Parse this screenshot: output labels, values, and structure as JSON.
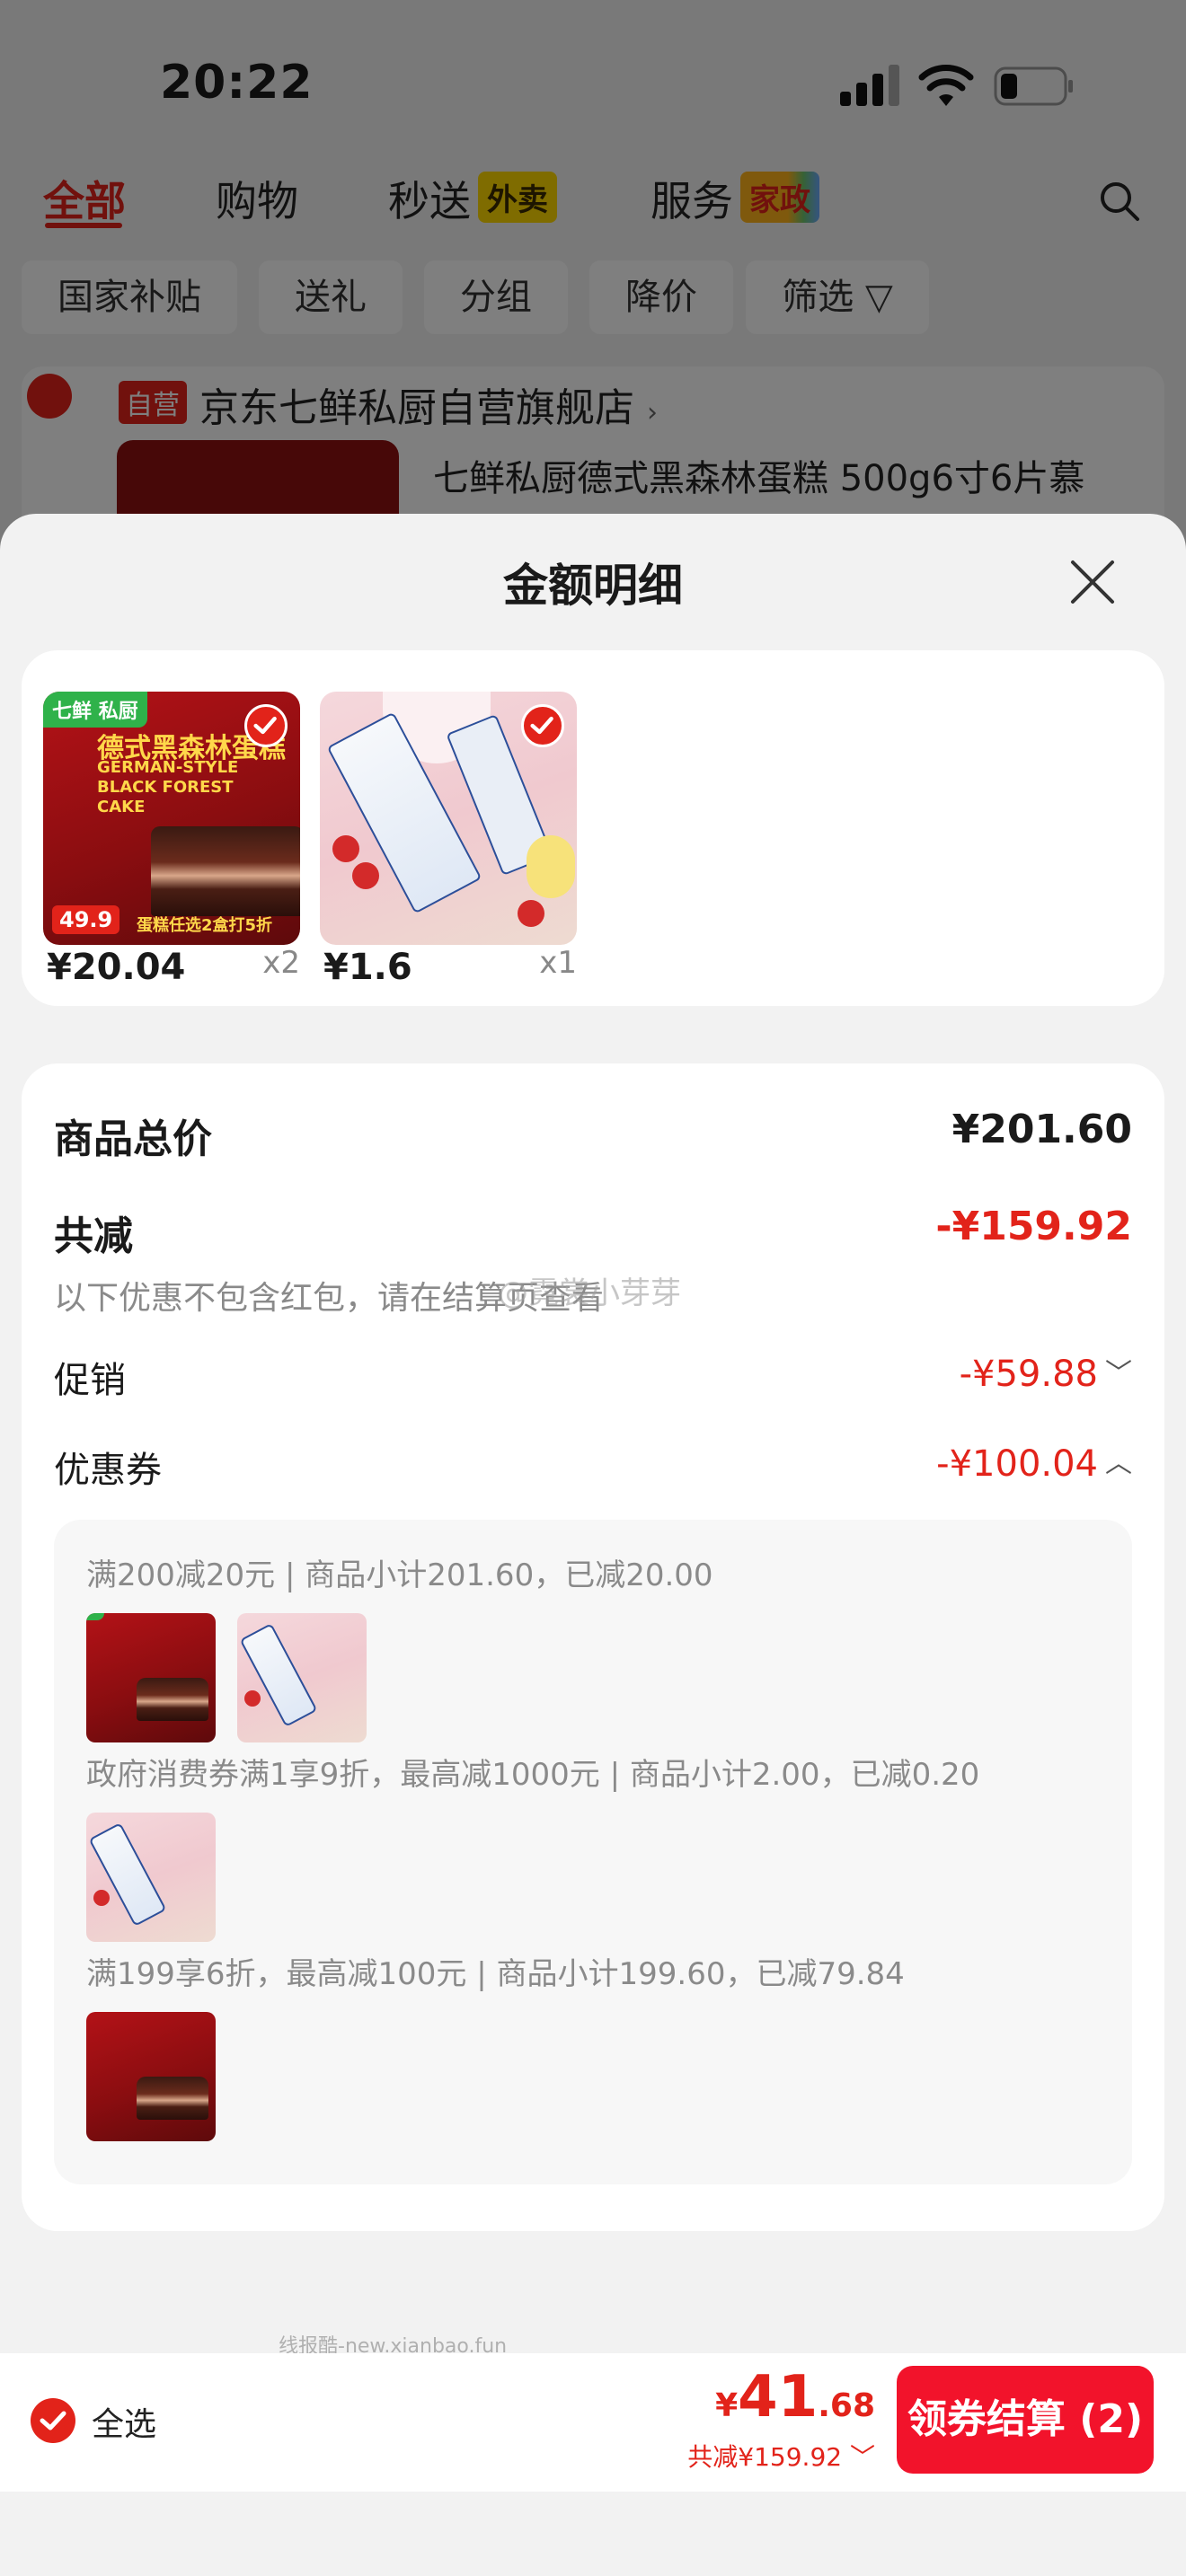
{
  "status_bar": {
    "time": "20:22"
  },
  "background": {
    "tabs": [
      {
        "label": "全部",
        "active": true
      },
      {
        "label": "购物"
      },
      {
        "label": "秒送",
        "badge": "外卖"
      },
      {
        "label": "服务",
        "badge": "家政"
      }
    ],
    "chips": [
      "国家补贴",
      "送礼",
      "分组",
      "降价",
      "筛选"
    ],
    "store": {
      "tag": "自营",
      "name": "京东七鲜私厨自营旗舰店",
      "product_title": "七鲜私厨德式黑森林蛋糕 500g6寸6片慕"
    }
  },
  "sheet": {
    "title": "金额明细",
    "products": [
      {
        "price": "¥20.04",
        "qty": "x2",
        "image": {
          "brand": "七鲜 私厨",
          "title": "德式黑森林蛋糕",
          "subtitle": "GERMAN-STYLE BLACK FOREST CAKE",
          "price_tag": "49.9",
          "promo": "蛋糕任选2盒打5折"
        }
      },
      {
        "price": "¥1.6",
        "qty": "x1",
        "image": {}
      }
    ],
    "summary": {
      "goods_total_label": "商品总价",
      "goods_total_value": "¥201.60",
      "discount_label": "共减",
      "discount_value": "-¥159.92",
      "note": "以下优惠不包含红包，请在结算页查看",
      "watermark": "@霓裳小芽芽",
      "promo_label": "促销",
      "promo_value": "-¥59.88",
      "coupon_label": "优惠券",
      "coupon_value": "-¥100.04"
    },
    "coupons": [
      {
        "text": "满200减20元 | 商品小计201.60，已减20.00",
        "images": [
          "cake",
          "milk"
        ]
      },
      {
        "text": "政府消费券满1享9折，最高减1000元 | 商品小计2.00，已减0.20",
        "images": [
          "milk"
        ]
      },
      {
        "text": "满199享6折，最高减100元 | 商品小计199.60，已减79.84",
        "images": [
          "cake"
        ]
      }
    ]
  },
  "source_watermark": "线报酷-new.xianbao.fun",
  "bottom_bar": {
    "select_all": "全选",
    "currency": "¥",
    "total_int": "41",
    "total_dec": ".68",
    "saved": "共减¥159.92",
    "checkout": "领券结算 (2)"
  },
  "colors": {
    "accent": "#e2231a",
    "button": "#f2132b"
  }
}
